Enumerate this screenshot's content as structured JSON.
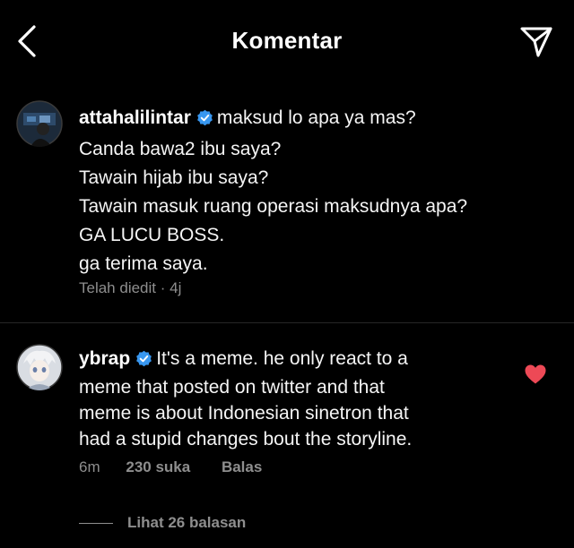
{
  "header": {
    "title": "Komentar",
    "back_icon": "chevron-left-icon",
    "send_icon": "paper-plane-icon"
  },
  "caption": {
    "username": "attahalilintar",
    "verified": true,
    "lines": [
      "maksud lo apa ya mas?",
      "Canda bawa2 ibu saya?",
      "Tawain hijab ibu saya?",
      "Tawain masuk ruang operasi maksudnya apa?",
      "GA LUCU BOSS.",
      "ga terima saya."
    ],
    "meta": "Telah diedit · 4j"
  },
  "comment": {
    "username": "ybrap",
    "verified": true,
    "lines": [
      "It's a meme. he only react to a",
      "meme that posted on twitter and that",
      "meme is about Indonesian sinetron that",
      "had a stupid changes bout the storyline."
    ],
    "time": "6m",
    "likes": "230 suka",
    "reply_label": "Balas",
    "liked": true,
    "view_replies": "Lihat 26 balasan"
  },
  "colors": {
    "background": "#000000",
    "text": "#f5f5f5",
    "secondary": "#8e8e8e",
    "verified_blue": "#3897f0",
    "like_red": "#ed4956",
    "divider": "#262626"
  }
}
